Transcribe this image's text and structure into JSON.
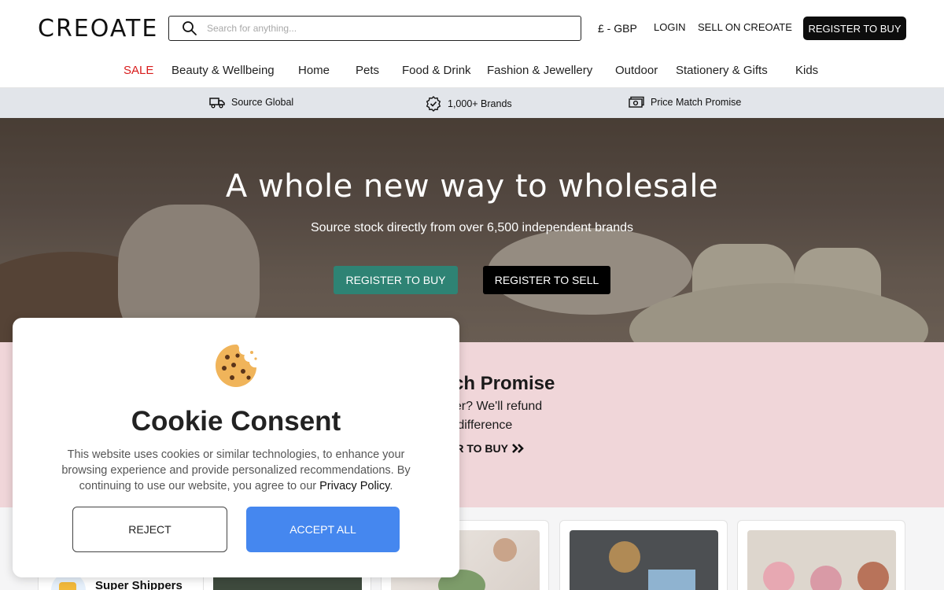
{
  "header": {
    "logo": "CREOATE",
    "search_placeholder": "Search for anything...",
    "currency": "£ - GBP",
    "login": "LOGIN",
    "sell": "SELL ON CREOATE",
    "register": "REGISTER TO BUY"
  },
  "nav": {
    "items": [
      "SALE",
      "Beauty & Wellbeing",
      "Home",
      "Pets",
      "Food & Drink",
      "Fashion & Jewellery",
      "Outdoor",
      "Stationery & Gifts",
      "Kids"
    ],
    "sale_color": "#d81b1b"
  },
  "strip": {
    "items": [
      {
        "label": "Source Global",
        "icon": "truck-icon"
      },
      {
        "label": "1,000+ Brands",
        "icon": "badge-check-icon"
      },
      {
        "label": "Price Match Promise",
        "icon": "money-icon"
      }
    ]
  },
  "hero": {
    "title": "A whole new way to wholesale",
    "subtitle": "Source stock directly from over 6,500 independent brands",
    "buy_button": "REGISTER TO BUY",
    "sell_button": "REGISTER TO SELL",
    "buy_color": "#2e8374"
  },
  "price_match": {
    "title": "tch Promise",
    "line1": "per? We'll refund",
    "line2": "e difference",
    "cta": "ER TO BUY"
  },
  "cards": {
    "first_label": "Super Shippers"
  },
  "cookie": {
    "title": "Cookie Consent",
    "text": "This website uses cookies or similar technologies, to enhance your browsing experience and provide personalized recommendations. By continuing to use our website, you agree to our",
    "link": "Privacy Policy",
    "period": ".",
    "reject": "REJECT",
    "accept": "ACCEPT ALL",
    "accept_color": "#4587ef"
  }
}
